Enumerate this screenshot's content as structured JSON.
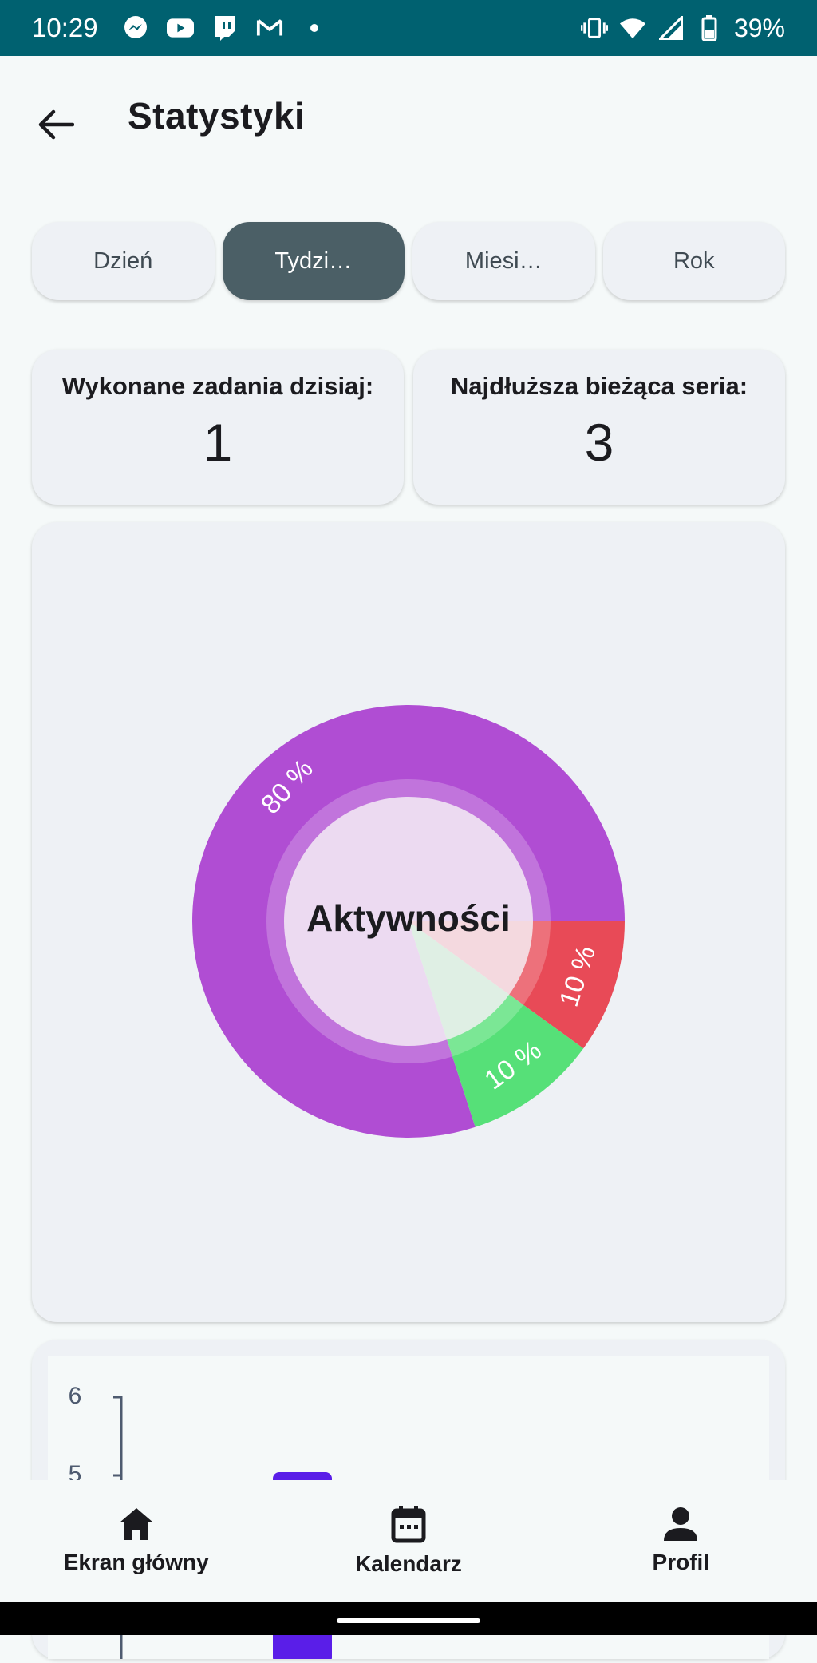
{
  "status_bar": {
    "time": "10:29",
    "battery": "39%",
    "icons": [
      "messenger-icon",
      "youtube-icon",
      "twitch-icon",
      "gmail-icon",
      "dot-icon",
      "vibrate-icon",
      "wifi-icon",
      "signal-icon",
      "battery-icon"
    ]
  },
  "header": {
    "title": "Statystyki"
  },
  "tabs": [
    {
      "label": "Dzień",
      "active": false
    },
    {
      "label": "Tydzi…",
      "active": true
    },
    {
      "label": "Miesi…",
      "active": false
    },
    {
      "label": "Rok",
      "active": false
    }
  ],
  "stats": {
    "tasks_today": {
      "label": "Wykonane zadania dzisiaj:",
      "value": "1"
    },
    "longest_streak": {
      "label": "Najdłuższa bieżąca seria:",
      "value": "3"
    }
  },
  "chart_data": [
    {
      "type": "pie",
      "title": "Aktywności",
      "slices": [
        {
          "label": "80 %",
          "value": 80,
          "color": "#b04dd3"
        },
        {
          "label": "10 %",
          "value": 10,
          "color": "#e84a57"
        },
        {
          "label": "10 %",
          "value": 10,
          "color": "#56e078"
        }
      ]
    },
    {
      "type": "bar",
      "yticks": [
        "6",
        "5"
      ],
      "bar_color": "#5a1ee8"
    }
  ],
  "bottom_nav": [
    {
      "label": "Ekran główny",
      "icon": "home-icon"
    },
    {
      "label": "Kalendarz",
      "icon": "calendar-icon"
    },
    {
      "label": "Profil",
      "icon": "person-icon"
    }
  ],
  "colors": {
    "status_bar": "#006170",
    "tab_active": "#4b5f66",
    "card_bg": "#eef1f5"
  }
}
